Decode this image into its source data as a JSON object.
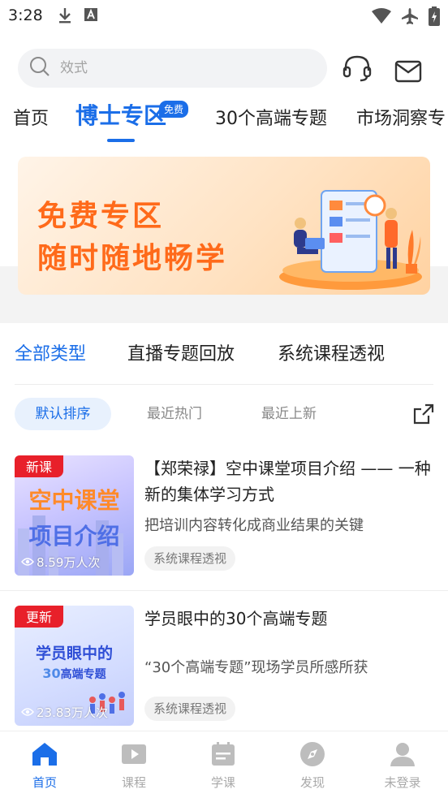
{
  "status_bar": {
    "time": "3:28"
  },
  "search": {
    "placeholder": "效式"
  },
  "top_tabs": [
    {
      "label": "首页"
    },
    {
      "label": "博士专区",
      "active": true
    },
    {
      "label": "30个高端专题"
    },
    {
      "label": "市场洞察专"
    }
  ],
  "free_badge": "免费",
  "banner": {
    "line1": "免费专区",
    "line2": "随时随地畅学"
  },
  "category_tabs": [
    {
      "label": "全部类型",
      "active": true
    },
    {
      "label": "直播专题回放"
    },
    {
      "label": "系统课程透视"
    }
  ],
  "sort_options": [
    {
      "label": "默认排序",
      "active": true
    },
    {
      "label": "最近热门"
    },
    {
      "label": "最近上新"
    }
  ],
  "courses": [
    {
      "badge": "新课",
      "thumb_text_1": "空中课堂",
      "thumb_text_2": "项目介绍",
      "views": "8.59万人次",
      "title": "【郑荣禄】空中课堂项目介绍 —— 一种新的集体学习方式",
      "subtitle": "把培训内容转化成商业结果的关键",
      "tag": "系统课程透视"
    },
    {
      "badge": "更新",
      "thumb_text_1": "学员眼中的",
      "thumb_text_2": "高端专题",
      "views": "23.83万人次",
      "title": "学员眼中的30个高端专题",
      "subtitle": "“30个高端专题”现场学员所感所获",
      "tag": "系统课程透视"
    }
  ],
  "bottom_nav": [
    {
      "label": "首页",
      "active": true
    },
    {
      "label": "课程"
    },
    {
      "label": "学课"
    },
    {
      "label": "发现"
    },
    {
      "label": "未登录"
    }
  ],
  "colors": {
    "accent": "#1b6ee8",
    "badge_red": "#e8202a",
    "banner_orange": "#ff6a1a"
  }
}
